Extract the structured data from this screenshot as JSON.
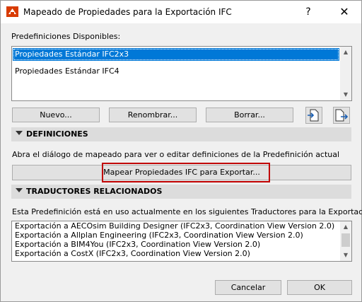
{
  "window": {
    "title": "Mapeado de Propiedades para la Exportación IFC",
    "help_label": "?",
    "close_label": "✕"
  },
  "presets": {
    "label": "Predefiniciones Disponibles:",
    "items": [
      {
        "label": "Propiedades Estándar IFC2x3",
        "selected": true
      },
      {
        "label": "Propiedades Estándar IFC4",
        "selected": false
      }
    ],
    "new_label": "Nuevo...",
    "rename_label": "Renombrar...",
    "delete_label": "Borrar...",
    "import_icon": "import-icon",
    "export_icon": "export-icon"
  },
  "definitions": {
    "title": "DEFINICIONES",
    "description": "Abra el diálogo de mapeado para ver o editar definiciones de la Predefinición actual",
    "map_button_label": "Mapear Propiedades IFC para Exportar..."
  },
  "translators": {
    "title": "TRADUCTORES RELACIONADOS",
    "description": "Esta Predefinición está en uso actualmente en los siguientes Traductores para la Exportación:",
    "items": [
      "Exportación a AECOsim Building Designer (IFC2x3, Coordination View Version 2.0)",
      "Exportación a Allplan Engineering (IFC2x3, Coordination View Version 2.0)",
      "Exportación a BIM4You (IFC2x3, Coordination View Version 2.0)",
      "Exportación a CostX (IFC2x3, Coordination View Version 2.0)"
    ]
  },
  "footer": {
    "cancel_label": "Cancelar",
    "ok_label": "OK"
  },
  "colors": {
    "selection": "#0078d7",
    "highlight_border": "#c00000",
    "dialog_bg": "#f0f0f0"
  }
}
